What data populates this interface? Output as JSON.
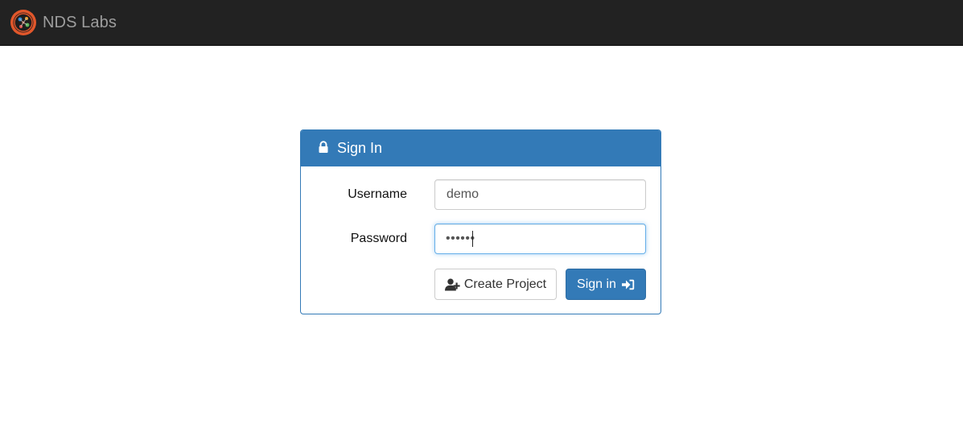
{
  "navbar": {
    "brand": "NDS Labs",
    "logo_icon": "nds-labs-logo-icon",
    "background": "#222222"
  },
  "signin_panel": {
    "title": "Sign In",
    "title_icon": "lock-icon",
    "accent": "#337ab7",
    "username": {
      "label": "Username",
      "value": "demo"
    },
    "password": {
      "label": "Password",
      "masked_value": "••••••"
    },
    "create_project_button": {
      "label": "Create Project",
      "icon": "user-plus-icon"
    },
    "signin_button": {
      "label": "Sign in",
      "icon": "sign-in-icon"
    }
  }
}
